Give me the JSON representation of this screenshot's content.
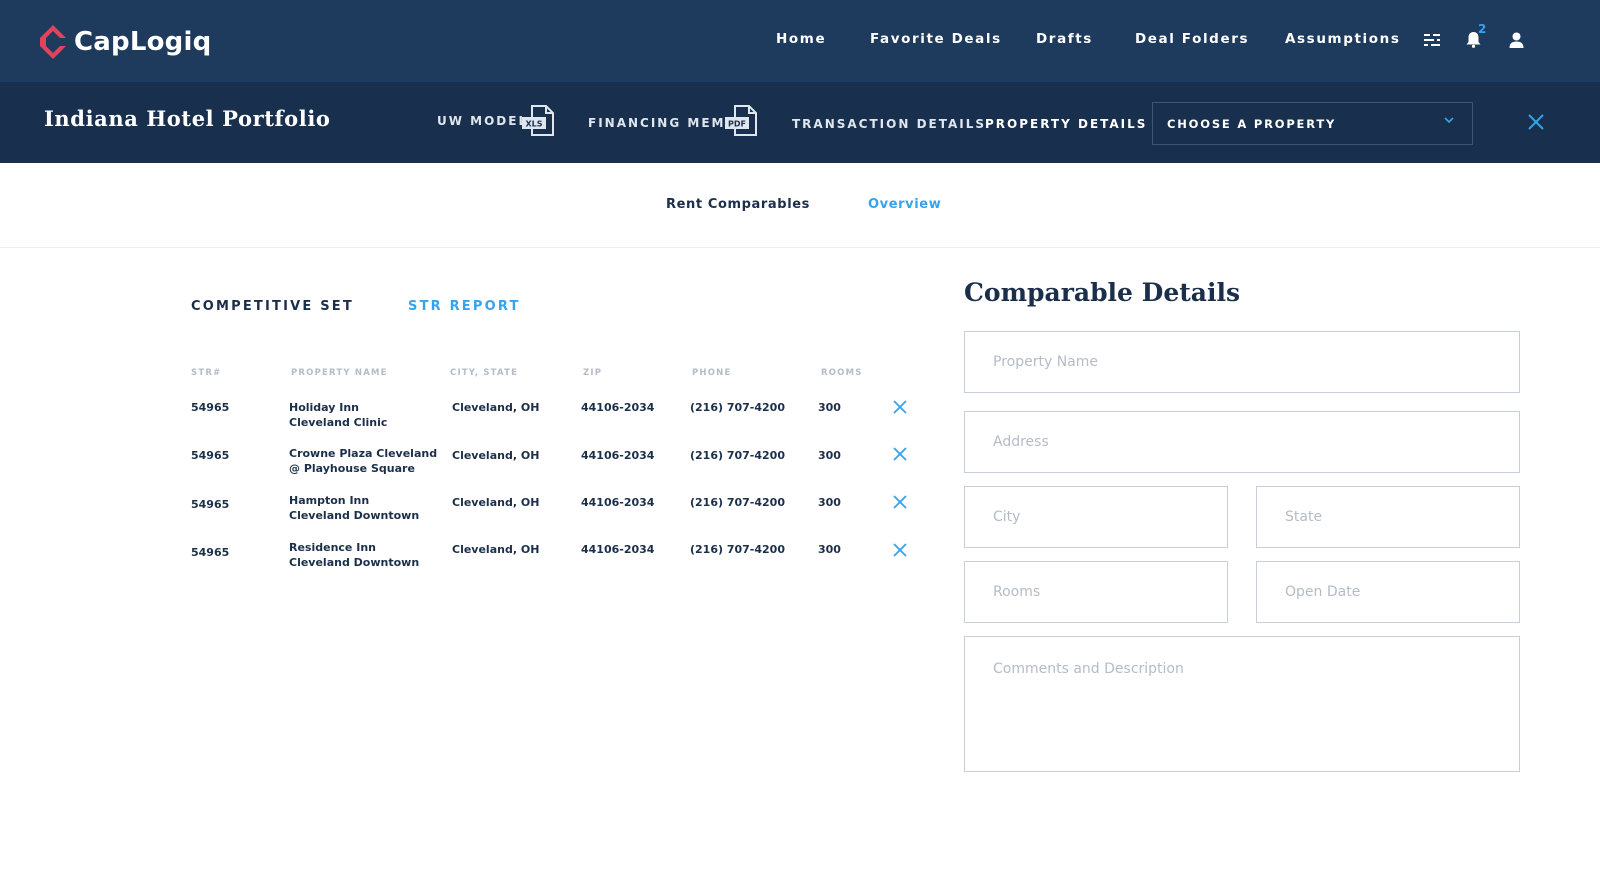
{
  "brand": {
    "name": "CapLogiq",
    "primary_color": "#1e3a5c",
    "secondary_bar_color": "#18304d",
    "accent_color": "#36a3ea",
    "logo_color": "#e0435c"
  },
  "topnav": {
    "links": [
      "Home",
      "Favorite Deals",
      "Drafts",
      "Deal Folders",
      "Assumptions"
    ],
    "icons": [
      "filter-list-icon",
      "bell-icon",
      "user-icon"
    ],
    "notification_count": "2"
  },
  "subbar": {
    "deal_title": "Indiana Hotel Portfolio",
    "uw_model": "UW MODEL",
    "uw_model_file": "XLS",
    "financing_memo": "FINANCING MEMO",
    "financing_memo_file": "PDF",
    "transaction_details": "TRANSACTION DETAILS",
    "property_details": "PROPERTY DETAILS",
    "property_select": "CHOOSE A PROPERTY"
  },
  "tabs": {
    "rent_comparables": "Rent Comparables",
    "overview": "Overview"
  },
  "left": {
    "competitive_set": "COMPETITIVE SET",
    "str_report": "STR REPORT",
    "columns": [
      "STR#",
      "PROPERTY NAME",
      "CITY, STATE",
      "ZIP",
      "PHONE",
      "ROOMS"
    ],
    "rows": [
      {
        "str": "54965",
        "name1": "Holiday Inn",
        "name2": "Cleveland Clinic",
        "city": "Cleveland, OH",
        "zip": "44106-2034",
        "phone": "(216) 707-4200",
        "rooms": "300"
      },
      {
        "str": "54965",
        "name1": "Crowne Plaza Cleveland",
        "name2": "@ Playhouse Square",
        "city": "Cleveland, OH",
        "zip": "44106-2034",
        "phone": "(216) 707-4200",
        "rooms": "300"
      },
      {
        "str": "54965",
        "name1": "Hampton Inn",
        "name2": "Cleveland Downtown",
        "city": "Cleveland, OH",
        "zip": "44106-2034",
        "phone": "(216) 707-4200",
        "rooms": "300"
      },
      {
        "str": "54965",
        "name1": "Residence Inn",
        "name2": "Cleveland Downtown",
        "city": "Cleveland, OH",
        "zip": "44106-2034",
        "phone": "(216) 707-4200",
        "rooms": "300"
      }
    ]
  },
  "right": {
    "title": "Comparable Details",
    "placeholders": {
      "property_name": "Property Name",
      "address": "Address",
      "city": "City",
      "state": "State",
      "rooms": "Rooms",
      "open_date": "Open Date",
      "comments": "Comments and Description"
    }
  }
}
